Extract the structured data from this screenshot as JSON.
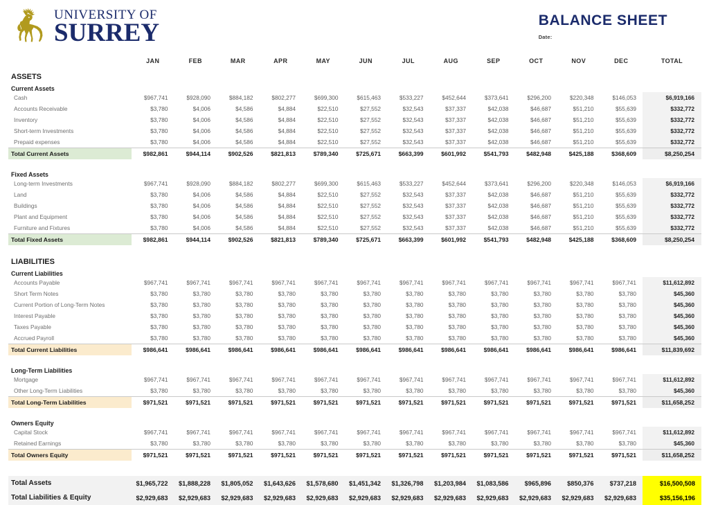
{
  "brand": {
    "line1": "UNIVERSITY OF",
    "line2": "SURREY",
    "logo_icon": "stag-icon",
    "logo_color": "#b19a1e",
    "text_color": "#1b2b6b"
  },
  "header": {
    "title": "BALANCE SHEET",
    "date_label": "Date:",
    "date_value": ""
  },
  "colors": {
    "navy": "#1b2b6b",
    "total_green": "#dcebd4",
    "total_cream": "#fbebcd",
    "grand_yellow": "#ffff00",
    "total_col_bg": "#f2f2f2"
  },
  "columns": {
    "label_header": "",
    "months": [
      "JAN",
      "FEB",
      "MAR",
      "APR",
      "MAY",
      "JUN",
      "JUL",
      "AUG",
      "SEP",
      "OCT",
      "NOV",
      "DEC"
    ],
    "total_header": "TOTAL"
  },
  "sections": [
    {
      "id": "assets",
      "heading": "ASSETS",
      "level": "major"
    },
    {
      "id": "current-assets",
      "heading": "Current Assets",
      "level": "minor",
      "rows": [
        {
          "label": "Cash",
          "values": [
            "$967,741",
            "$928,090",
            "$884,182",
            "$802,277",
            "$699,300",
            "$615,463",
            "$533,227",
            "$452,644",
            "$373,641",
            "$296,200",
            "$220,348",
            "$146,053"
          ],
          "total": "$6,919,166"
        },
        {
          "label": "Accounts Receivable",
          "values": [
            "$3,780",
            "$4,006",
            "$4,586",
            "$4,884",
            "$22,510",
            "$27,552",
            "$32,543",
            "$37,337",
            "$42,038",
            "$46,687",
            "$51,210",
            "$55,639"
          ],
          "total": "$332,772"
        },
        {
          "label": "Inventory",
          "values": [
            "$3,780",
            "$4,006",
            "$4,586",
            "$4,884",
            "$22,510",
            "$27,552",
            "$32,543",
            "$37,337",
            "$42,038",
            "$46,687",
            "$51,210",
            "$55,639"
          ],
          "total": "$332,772"
        },
        {
          "label": "Short-term Investments",
          "values": [
            "$3,780",
            "$4,006",
            "$4,586",
            "$4,884",
            "$22,510",
            "$27,552",
            "$32,543",
            "$37,337",
            "$42,038",
            "$46,687",
            "$51,210",
            "$55,639"
          ],
          "total": "$332,772"
        },
        {
          "label": "Prepaid expenses",
          "values": [
            "$3,780",
            "$4,006",
            "$4,586",
            "$4,884",
            "$22,510",
            "$27,552",
            "$32,543",
            "$37,337",
            "$42,038",
            "$46,687",
            "$51,210",
            "$55,639"
          ],
          "total": "$332,772"
        }
      ],
      "total_row": {
        "label": "Total Current Assets",
        "highlight": "green",
        "values": [
          "$982,861",
          "$944,114",
          "$902,526",
          "$821,813",
          "$789,340",
          "$725,671",
          "$663,399",
          "$601,992",
          "$541,793",
          "$482,948",
          "$425,188",
          "$368,609"
        ],
        "total": "$8,250,254"
      }
    },
    {
      "id": "fixed-assets",
      "heading": "Fixed Assets",
      "level": "minor",
      "rows": [
        {
          "label": "Long-term Investments",
          "values": [
            "$967,741",
            "$928,090",
            "$884,182",
            "$802,277",
            "$699,300",
            "$615,463",
            "$533,227",
            "$452,644",
            "$373,641",
            "$296,200",
            "$220,348",
            "$146,053"
          ],
          "total": "$6,919,166"
        },
        {
          "label": "Land",
          "values": [
            "$3,780",
            "$4,006",
            "$4,586",
            "$4,884",
            "$22,510",
            "$27,552",
            "$32,543",
            "$37,337",
            "$42,038",
            "$46,687",
            "$51,210",
            "$55,639"
          ],
          "total": "$332,772"
        },
        {
          "label": "Buildings",
          "values": [
            "$3,780",
            "$4,006",
            "$4,586",
            "$4,884",
            "$22,510",
            "$27,552",
            "$32,543",
            "$37,337",
            "$42,038",
            "$46,687",
            "$51,210",
            "$55,639"
          ],
          "total": "$332,772"
        },
        {
          "label": "Plant and Equipment",
          "values": [
            "$3,780",
            "$4,006",
            "$4,586",
            "$4,884",
            "$22,510",
            "$27,552",
            "$32,543",
            "$37,337",
            "$42,038",
            "$46,687",
            "$51,210",
            "$55,639"
          ],
          "total": "$332,772"
        },
        {
          "label": "Furniture and Fixtures",
          "values": [
            "$3,780",
            "$4,006",
            "$4,586",
            "$4,884",
            "$22,510",
            "$27,552",
            "$32,543",
            "$37,337",
            "$42,038",
            "$46,687",
            "$51,210",
            "$55,639"
          ],
          "total": "$332,772"
        }
      ],
      "total_row": {
        "label": "Total Fixed Assets",
        "highlight": "green",
        "values": [
          "$982,861",
          "$944,114",
          "$902,526",
          "$821,813",
          "$789,340",
          "$725,671",
          "$663,399",
          "$601,992",
          "$541,793",
          "$482,948",
          "$425,188",
          "$368,609"
        ],
        "total": "$8,250,254"
      }
    },
    {
      "id": "liabilities",
      "heading": "LIABILITIES",
      "level": "major"
    },
    {
      "id": "current-liabilities",
      "heading": "Current Liabilities",
      "level": "minor",
      "rows": [
        {
          "label": "Accounts Payable",
          "values": [
            "$967,741",
            "$967,741",
            "$967,741",
            "$967,741",
            "$967,741",
            "$967,741",
            "$967,741",
            "$967,741",
            "$967,741",
            "$967,741",
            "$967,741",
            "$967,741"
          ],
          "total": "$11,612,892"
        },
        {
          "label": "Short Term Notes",
          "values": [
            "$3,780",
            "$3,780",
            "$3,780",
            "$3,780",
            "$3,780",
            "$3,780",
            "$3,780",
            "$3,780",
            "$3,780",
            "$3,780",
            "$3,780",
            "$3,780"
          ],
          "total": "$45,360"
        },
        {
          "label": "Current Portion of Long-Term Notes",
          "values": [
            "$3,780",
            "$3,780",
            "$3,780",
            "$3,780",
            "$3,780",
            "$3,780",
            "$3,780",
            "$3,780",
            "$3,780",
            "$3,780",
            "$3,780",
            "$3,780"
          ],
          "total": "$45,360"
        },
        {
          "label": "Interest Payable",
          "values": [
            "$3,780",
            "$3,780",
            "$3,780",
            "$3,780",
            "$3,780",
            "$3,780",
            "$3,780",
            "$3,780",
            "$3,780",
            "$3,780",
            "$3,780",
            "$3,780"
          ],
          "total": "$45,360"
        },
        {
          "label": "Taxes Payable",
          "values": [
            "$3,780",
            "$3,780",
            "$3,780",
            "$3,780",
            "$3,780",
            "$3,780",
            "$3,780",
            "$3,780",
            "$3,780",
            "$3,780",
            "$3,780",
            "$3,780"
          ],
          "total": "$45,360"
        },
        {
          "label": "Accrued Payroll",
          "values": [
            "$3,780",
            "$3,780",
            "$3,780",
            "$3,780",
            "$3,780",
            "$3,780",
            "$3,780",
            "$3,780",
            "$3,780",
            "$3,780",
            "$3,780",
            "$3,780"
          ],
          "total": "$45,360"
        }
      ],
      "total_row": {
        "label": "Total Current Liabilities",
        "highlight": "cream",
        "values": [
          "$986,641",
          "$986,641",
          "$986,641",
          "$986,641",
          "$986,641",
          "$986,641",
          "$986,641",
          "$986,641",
          "$986,641",
          "$986,641",
          "$986,641",
          "$986,641"
        ],
        "total": "$11,839,692"
      }
    },
    {
      "id": "long-term-liabilities",
      "heading": "Long-Term Liabilities",
      "level": "minor",
      "rows": [
        {
          "label": "Mortgage",
          "values": [
            "$967,741",
            "$967,741",
            "$967,741",
            "$967,741",
            "$967,741",
            "$967,741",
            "$967,741",
            "$967,741",
            "$967,741",
            "$967,741",
            "$967,741",
            "$967,741"
          ],
          "total": "$11,612,892"
        },
        {
          "label": "Other Long-Term Liabilities",
          "values": [
            "$3,780",
            "$3,780",
            "$3,780",
            "$3,780",
            "$3,780",
            "$3,780",
            "$3,780",
            "$3,780",
            "$3,780",
            "$3,780",
            "$3,780",
            "$3,780"
          ],
          "total": "$45,360"
        }
      ],
      "total_row": {
        "label": "Total Long-Term Liabilities",
        "highlight": "cream",
        "values": [
          "$971,521",
          "$971,521",
          "$971,521",
          "$971,521",
          "$971,521",
          "$971,521",
          "$971,521",
          "$971,521",
          "$971,521",
          "$971,521",
          "$971,521",
          "$971,521"
        ],
        "total": "$11,658,252"
      }
    },
    {
      "id": "owners-equity",
      "heading": "Owners Equity",
      "level": "minor",
      "rows": [
        {
          "label": "Capital Stock",
          "values": [
            "$967,741",
            "$967,741",
            "$967,741",
            "$967,741",
            "$967,741",
            "$967,741",
            "$967,741",
            "$967,741",
            "$967,741",
            "$967,741",
            "$967,741",
            "$967,741"
          ],
          "total": "$11,612,892"
        },
        {
          "label": "Retained Earnings",
          "values": [
            "$3,780",
            "$3,780",
            "$3,780",
            "$3,780",
            "$3,780",
            "$3,780",
            "$3,780",
            "$3,780",
            "$3,780",
            "$3,780",
            "$3,780",
            "$3,780"
          ],
          "total": "$45,360"
        }
      ],
      "total_row": {
        "label": "Total Owners Equity",
        "highlight": "cream",
        "values": [
          "$971,521",
          "$971,521",
          "$971,521",
          "$971,521",
          "$971,521",
          "$971,521",
          "$971,521",
          "$971,521",
          "$971,521",
          "$971,521",
          "$971,521",
          "$971,521"
        ],
        "total": "$11,658,252"
      }
    }
  ],
  "grand_totals": [
    {
      "label": "Total Assets",
      "values": [
        "$1,965,722",
        "$1,888,228",
        "$1,805,052",
        "$1,643,626",
        "$1,578,680",
        "$1,451,342",
        "$1,326,798",
        "$1,203,984",
        "$1,083,586",
        "$965,896",
        "$850,376",
        "$737,218"
      ],
      "total": "$16,500,508"
    },
    {
      "label": "Total Liabilities & Equity",
      "values": [
        "$2,929,683",
        "$2,929,683",
        "$2,929,683",
        "$2,929,683",
        "$2,929,683",
        "$2,929,683",
        "$2,929,683",
        "$2,929,683",
        "$2,929,683",
        "$2,929,683",
        "$2,929,683",
        "$2,929,683"
      ],
      "total": "$35,156,196"
    }
  ]
}
